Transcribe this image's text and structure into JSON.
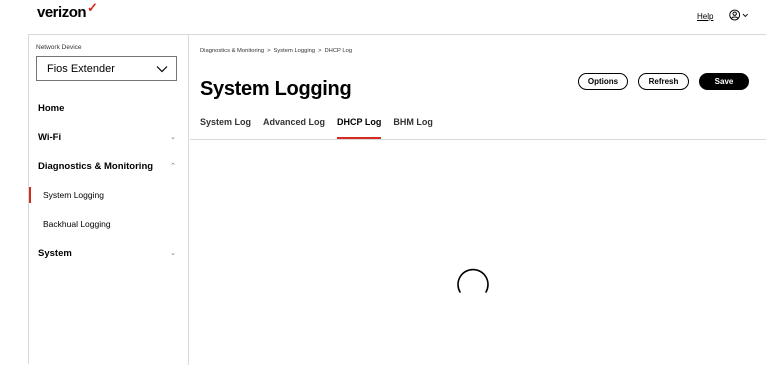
{
  "header": {
    "logo_text": "verizon",
    "logo_mark": "✓",
    "help_label": "Help",
    "user_icon": "user-circle-icon",
    "accent_color": "#d52b1e"
  },
  "sidebar": {
    "device_label": "Network Device",
    "device_selected": "Fios Extender",
    "items": [
      {
        "label": "Home"
      },
      {
        "label": "Wi-Fi",
        "chevron": "⌄"
      },
      {
        "label": "Diagnostics & Monitoring",
        "chevron": "⌃"
      },
      {
        "label": "System Logging",
        "active": true
      },
      {
        "label": "Backhual Logging"
      },
      {
        "label": "System",
        "chevron": "⌄"
      }
    ]
  },
  "main": {
    "breadcrumb": [
      "Diagnostics & Monitoring",
      "System Logging",
      "DHCP Log"
    ],
    "breadcrumb_sep": ">",
    "title": "System Logging",
    "buttons": {
      "options": "Options",
      "refresh": "Refresh",
      "save": "Save"
    },
    "tabs": [
      {
        "label": "System Log"
      },
      {
        "label": "Advanced Log"
      },
      {
        "label": "DHCP Log",
        "active": true
      },
      {
        "label": "BHM Log"
      }
    ]
  }
}
